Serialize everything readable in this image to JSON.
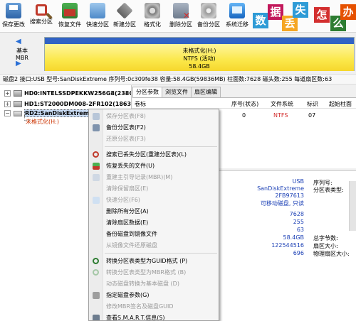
{
  "toolbar": {
    "buttons": [
      {
        "label": "保存更改",
        "icon": "save-icon"
      },
      {
        "label": "搜索分区",
        "icon": "search-icon"
      },
      {
        "label": "恢复文件",
        "icon": "recover-file-icon"
      },
      {
        "label": "快速分区",
        "icon": "quick-partition-icon"
      },
      {
        "label": "新建分区",
        "icon": "new-partition-icon"
      },
      {
        "label": "格式化",
        "icon": "format-icon"
      },
      {
        "label": "删除分区",
        "icon": "delete-partition-icon"
      },
      {
        "label": "备份分区",
        "icon": "backup-partition-icon"
      },
      {
        "label": "系统迁移",
        "icon": "system-migrate-icon"
      }
    ],
    "banner": {
      "chars": [
        "数",
        "据",
        "丢",
        "失",
        "怎",
        "么",
        "办"
      ],
      "colors": [
        "#2e9bd6",
        "#c2185b",
        "#f5a623",
        "#2e9bd6",
        "#d32f2f",
        "#2e7d32",
        "#e65100"
      ]
    }
  },
  "disk_map": {
    "disk_label_line1": "基本",
    "disk_label_line2": "MBR",
    "partition_name": "未格式化(H:)",
    "partition_fs": "NTFS (活动)",
    "partition_size": "58.4GB",
    "nav_left": "◀",
    "nav_right": "▶"
  },
  "info_line": "磁盘2 接口:USB  型号:SanDiskExtreme  序列号:0c309fe38  容量:58.4GB(59836MB)  柱面数:7628  磁头数:255  每道扇区数:63",
  "tree": {
    "hd0": "HD0:INTELSSDPEKKW256G8(238G",
    "hd1": "HD1:ST2000DM008-2FR102(1863G",
    "rd2": "RD2:SanDiskExtreme",
    "partition": "未格式化(H:)"
  },
  "tabs": [
    "分区参数",
    "浏览文件",
    "扇区编辑"
  ],
  "table": {
    "headers": [
      "卷标",
      "序号(状态)",
      "文件系统",
      "标识",
      "起始柱面"
    ],
    "row": {
      "seq": "0",
      "fs": "NTFS",
      "id": "07"
    }
  },
  "details": {
    "values": [
      "USB",
      "SanDiskExtreme",
      "2FB97613",
      "可移动磁盘, 只读"
    ],
    "labels_right": [
      "序列号:",
      "分区表类型:"
    ],
    "numbers": [
      "7628",
      "255",
      "63",
      "58.4GB",
      "122544516",
      "696"
    ],
    "labels_bottom": [
      "总字节数:",
      "扇区大小:",
      "物理扇区大小:"
    ]
  },
  "context_menu": {
    "items": [
      {
        "label": "保存分区表(F8)",
        "disabled": true
      },
      {
        "label": "备份分区表(F2)",
        "disabled": false
      },
      {
        "label": "还原分区表(F3)",
        "disabled": true
      },
      {
        "label": "搜索已丢失分区(重建分区表)(L)",
        "disabled": false
      },
      {
        "label": "恢复丢失的文件(U)",
        "disabled": false
      },
      {
        "label": "重建主引导记录(MBR)(M)",
        "disabled": true
      },
      {
        "label": "清除保留扇区(E)",
        "disabled": true
      },
      {
        "label": "快速分区(F6)",
        "disabled": true
      },
      {
        "label": "删除所有分区(A)",
        "disabled": false
      },
      {
        "label": "清除扇区数据(E)",
        "disabled": false
      },
      {
        "label": "备份磁盘到镜像文件",
        "disabled": false
      },
      {
        "label": "从镜像文件还原磁盘",
        "disabled": true
      },
      {
        "label": "转换分区表类型为GUID格式 (P)",
        "disabled": false
      },
      {
        "label": "转换分区表类型为MBR格式 (B)",
        "disabled": true
      },
      {
        "label": "动态磁盘转换为基本磁盘 (D)",
        "disabled": true
      },
      {
        "label": "指定磁盘参数(G)",
        "disabled": false
      },
      {
        "label": "修改MBR签名及磁盘GUID",
        "disabled": true
      },
      {
        "label": "查看S.M.A.R.T.信息(S)",
        "disabled": false
      }
    ]
  }
}
